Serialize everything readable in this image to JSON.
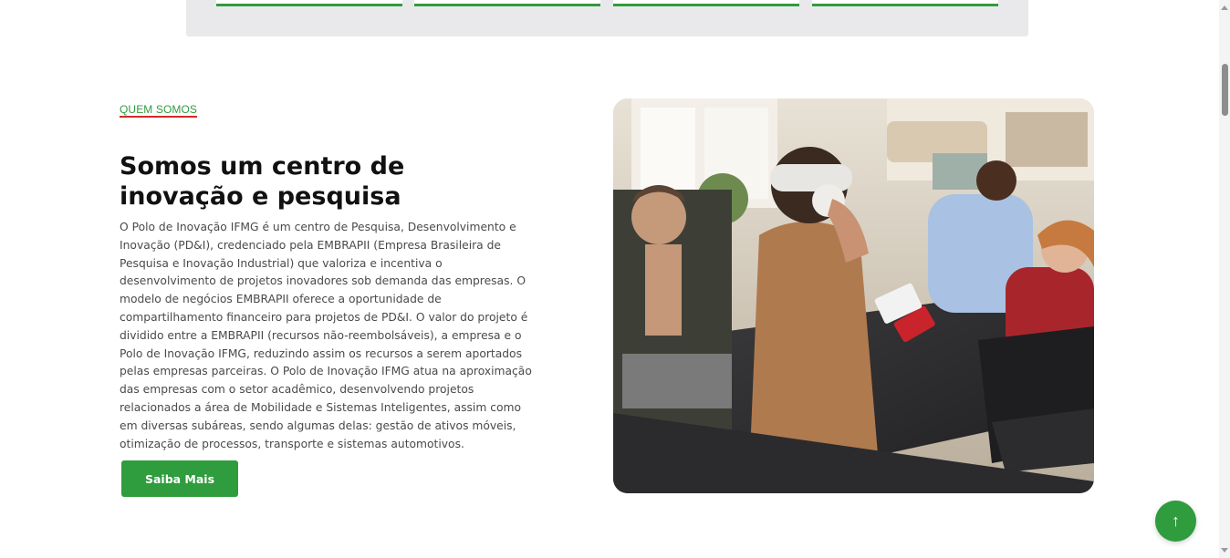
{
  "section": {
    "eyebrow": "QUEM SOMOS",
    "title": "Somos um centro de inovação e pesquisa",
    "paragraph": "O Polo de Inovação IFMG é um centro de Pesquisa, Desenvolvimento e Inovação (PD&I), credenciado pela EMBRAPII (Empresa Brasileira de Pesquisa e Inovação Industrial) que valoriza e incentiva o desenvolvimento de projetos inovadores sob demanda das empresas. O modelo de negócios EMBRAPII oferece a oportunidade de compartilhamento financeiro para projetos de PD&I. O valor do projeto é dividido entre a EMBRAPII (recursos não-reembolsáveis), a empresa e o Polo de Inovação IFMG, reduzindo assim os recursos a serem aportados pelas empresas parceiras. O Polo de Inovação IFMG atua na aproximação das empresas com o setor acadêmico, desenvolvendo projetos relacionados a área de Mobilidade e Sistemas Inteligentes, assim como em diversas subáreas, sendo algumas delas: gestão de ativos móveis, otimização de processos, transporte e sistemas automotivos.",
    "button_label": "Saiba Mais"
  },
  "scroll_top": {
    "icon": "arrow-up-icon",
    "glyph": "↑"
  },
  "colors": {
    "accent": "#2f9c3e",
    "underline": "#d22b2b",
    "band": "#e9e9ec"
  }
}
